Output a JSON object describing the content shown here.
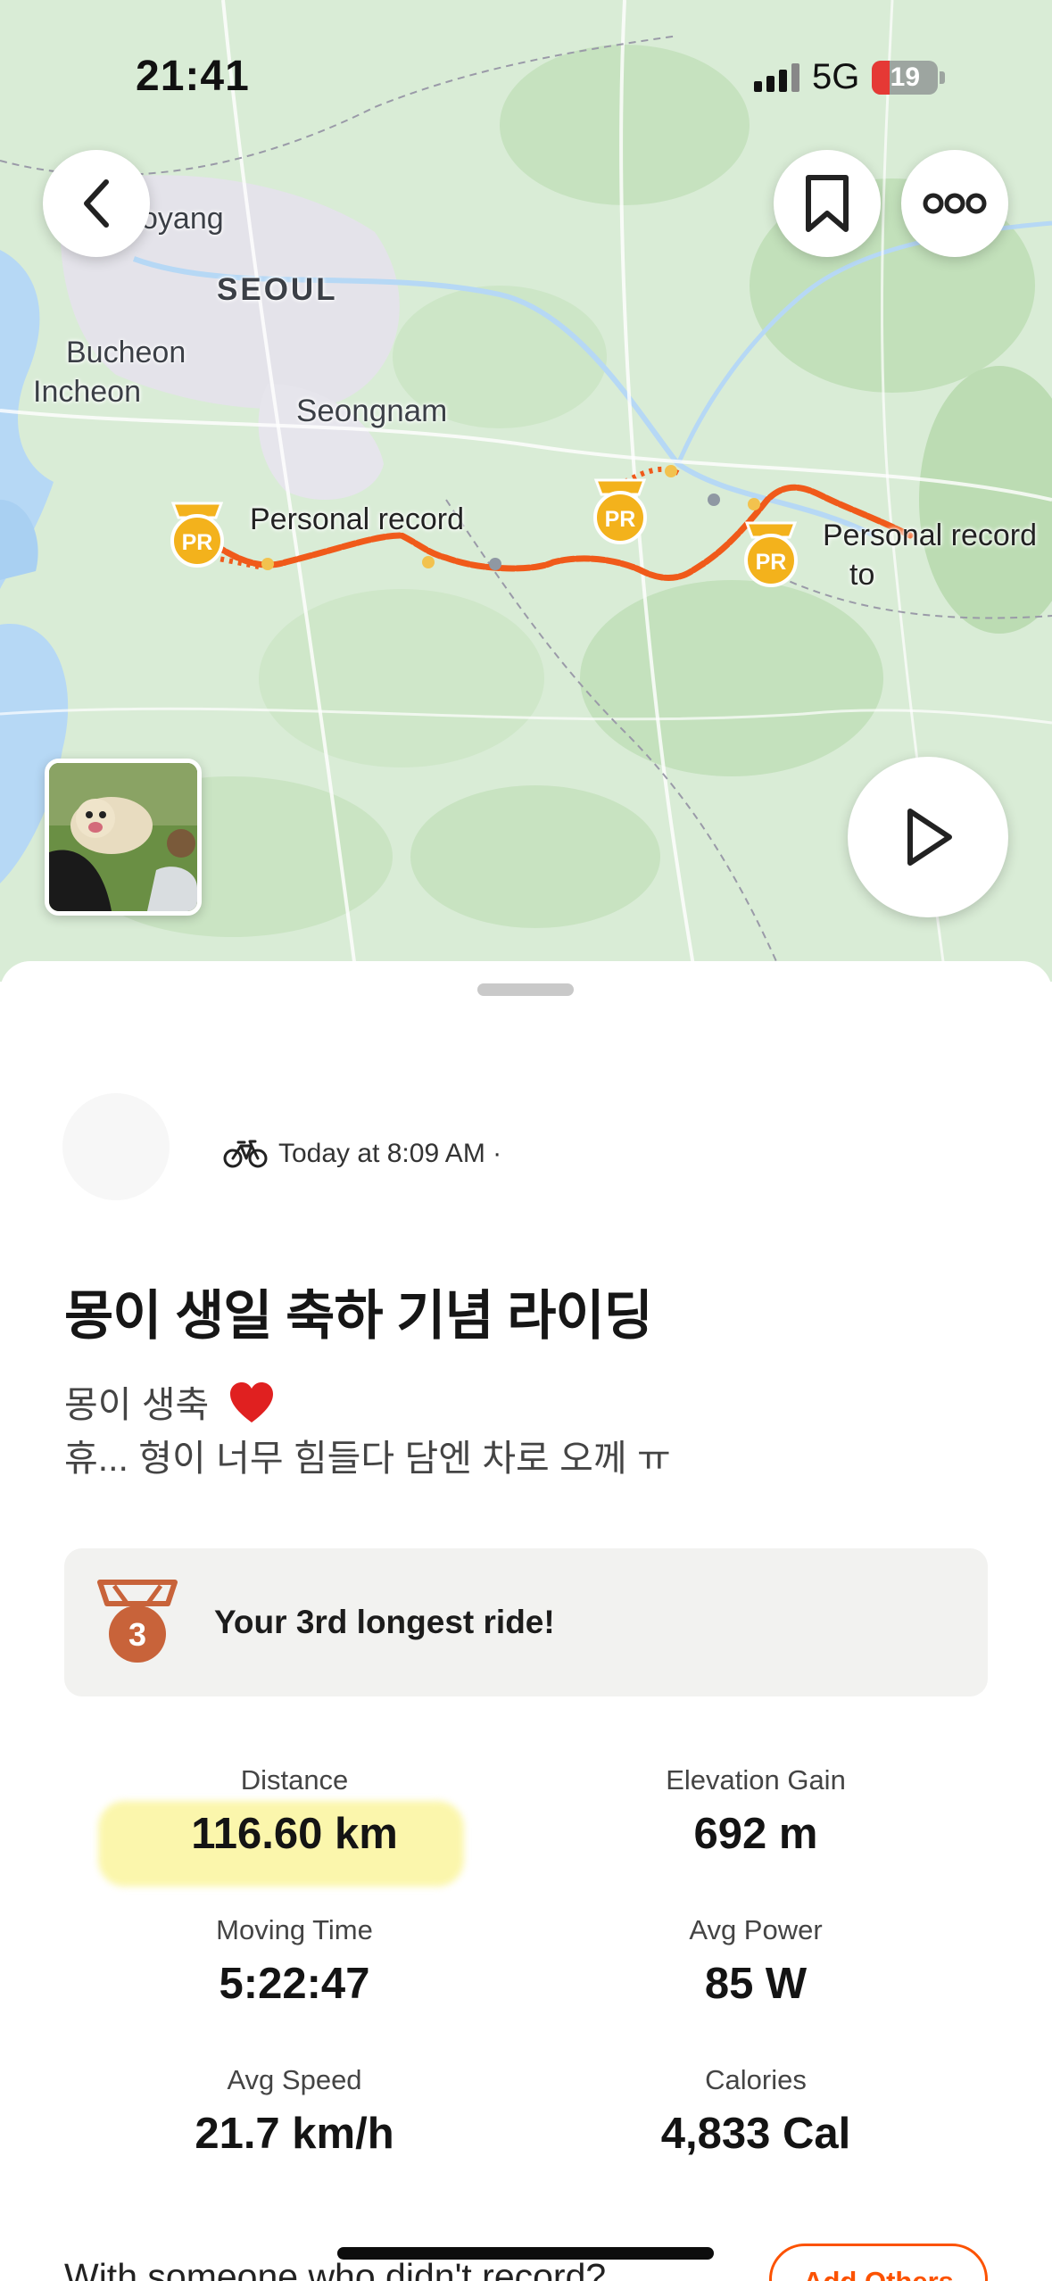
{
  "status_bar": {
    "time": "21:41",
    "network": "5G",
    "battery_level": "19",
    "battery_color": "#e53935"
  },
  "map": {
    "labels": {
      "goyang": "oyang",
      "seoul": "SEOUL",
      "bucheon": "Bucheon",
      "incheon": "Incheon",
      "seongnam": "Seongnam",
      "pr_1": "Personal record",
      "pr_2": "Personal record",
      "pr_2_sub": "to"
    },
    "pr_badge_text": "PR",
    "route_color": "#f05a1a",
    "badge_color": "#f3b21c"
  },
  "buttons": {
    "back_icon": "chevron-left-icon",
    "bookmark_icon": "bookmark-icon",
    "more_icon": "more-horizontal-icon",
    "play_icon": "play-icon"
  },
  "activity": {
    "sport_icon": "bike-icon",
    "time": "Today at 8:09 AM ·",
    "title": "몽이 생일 축하 기념 라이딩",
    "description_line_1": "몽이 생축",
    "description_line_2": "휴...   형이 너무 힘들다 담엔 차로 오께 ㅠ",
    "achievement": {
      "rank": "3",
      "text": "Your 3rd longest ride!"
    }
  },
  "stats": [
    {
      "label": "Distance",
      "value": "116.60 km"
    },
    {
      "label": "Elevation Gain",
      "value": "692 m"
    },
    {
      "label": "Moving Time",
      "value": "5:22:47"
    },
    {
      "label": "Avg Power",
      "value": "85 W"
    },
    {
      "label": "Avg Speed",
      "value": "21.7 km/h"
    },
    {
      "label": "Calories",
      "value": "4,833 Cal"
    }
  ],
  "footer": {
    "with_someone": "With someone who didn't record?",
    "add_others": "Add Others"
  },
  "colors": {
    "brand": "#fc5200",
    "highlight": "#fbf6a8",
    "card_bg": "#f2f2f0",
    "medal": "#c8633a"
  }
}
